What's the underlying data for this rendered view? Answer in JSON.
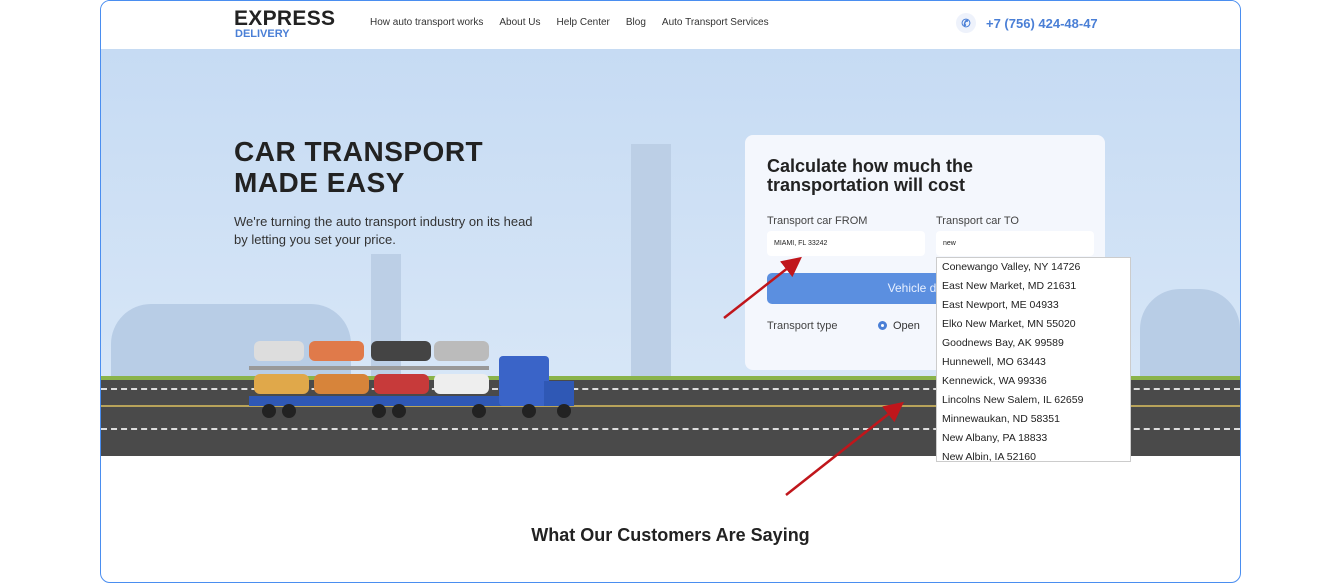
{
  "header": {
    "logo_top": "EXPRESS",
    "logo_bottom": "DELIVERY",
    "nav": [
      "How auto transport works",
      "About Us",
      "Help Center",
      "Blog",
      "Auto Transport Services"
    ],
    "phone": "+7 (756) 424-48-47"
  },
  "hero": {
    "title_line1": "CAR TRANSPORT",
    "title_line2": "MADE EASY",
    "subtitle": "We're turning the auto transport industry on its head by letting you set your price."
  },
  "calculator": {
    "title": "Calculate how much the transportation will cost",
    "from_label": "Transport car FROM",
    "from_value": "MIAMI, FL 33242",
    "to_label": "Transport car TO",
    "to_value": "new",
    "button": "Vehicle details",
    "transport_type_label": "Transport type",
    "option_open": "Open",
    "suggestions": [
      "Conewango Valley, NY 14726",
      "East New Market, MD 21631",
      "East Newport, ME 04933",
      "Elko New Market, MN 55020",
      "Goodnews Bay, AK 99589",
      "Hunnewell, MO 63443",
      "Kennewick, WA 99336",
      "Lincolns New Salem, IL 62659",
      "Minnewaukan, ND 58351",
      "New Albany, PA 18833",
      "New Albin, IA 52160"
    ]
  },
  "testimonials": {
    "title": "What Our Customers Are Saying"
  },
  "colors": {
    "accent": "#4a7fd6",
    "button": "#5b8fe0",
    "arrow": "#c0161b"
  }
}
